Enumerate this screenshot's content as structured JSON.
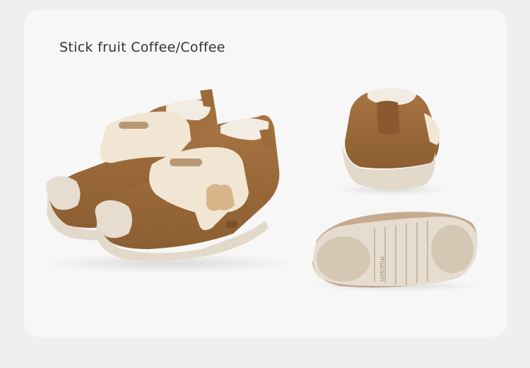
{
  "product": {
    "title": "Stick fruit Coffee/Coffee",
    "brand_mark": "mucoon"
  },
  "colors": {
    "upper": "#9c6b3a",
    "sole": "#e6ddd0",
    "strap": "#f1e6d4"
  }
}
